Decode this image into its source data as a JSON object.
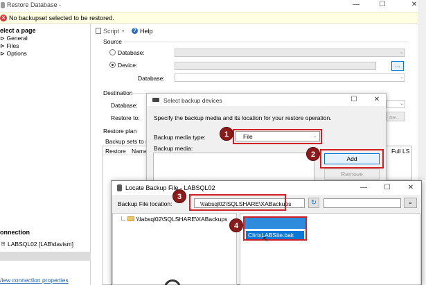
{
  "main_window": {
    "title": "Restore Database -",
    "minimize": "—",
    "maximize": "☐",
    "close": "✕"
  },
  "warning": {
    "text": "No backupset selected to be restored.",
    "icon": "error-icon"
  },
  "left_panel": {
    "select_page_heading": "elect a page",
    "pages": [
      "General",
      "Files",
      "Options"
    ],
    "connection_heading": "onnection",
    "connection_value": "LABSQL02 [LAB\\davism]",
    "view_connection_link": "/iew connection properties"
  },
  "toolbar": {
    "script_label": "Script",
    "help_label": "Help"
  },
  "source": {
    "heading": "Source",
    "database_label": "Database:",
    "device_label": "Device:",
    "device_database_label": "Database:",
    "browse_label": "...",
    "selected": "device"
  },
  "destination": {
    "heading": "Destination",
    "database_label": "Database:",
    "restore_to_label": "Restore to:",
    "truncated_button": "ne..."
  },
  "restore_plan": {
    "heading": "Restore plan",
    "backup_sets_label": "Backup sets to res",
    "columns": [
      "Restore",
      "Name"
    ],
    "right_column": "Full LS"
  },
  "select_backup_devices": {
    "title": "Select backup devices",
    "description": "Specify the backup media and its location for your restore operation.",
    "media_type_label": "Backup media type:",
    "media_type_value": "File",
    "media_label": "Backup media:",
    "add_label": "Add",
    "remove_label": "Remove",
    "maximize": "☐",
    "close": "✕"
  },
  "locate_backup_file": {
    "title": "Locate Backup File - LABSQL02",
    "location_label": "Backup File location:",
    "location_value": "\\\\labsql02\\SQLSHARE\\XABackups",
    "tree_root": "\\\\labsql02\\SQLSHARE\\XABackups",
    "selected_file": "CitrixLABSite.bak",
    "minimize": "—",
    "maximize": "☐",
    "close": "✕"
  },
  "callouts": [
    "1",
    "2",
    "3",
    "4"
  ],
  "colors": {
    "callout": "#8b1a1a",
    "highlight_box": "#d11f24",
    "warning_bg": "#ffffe1",
    "selection_blue": "#0b78d7"
  }
}
